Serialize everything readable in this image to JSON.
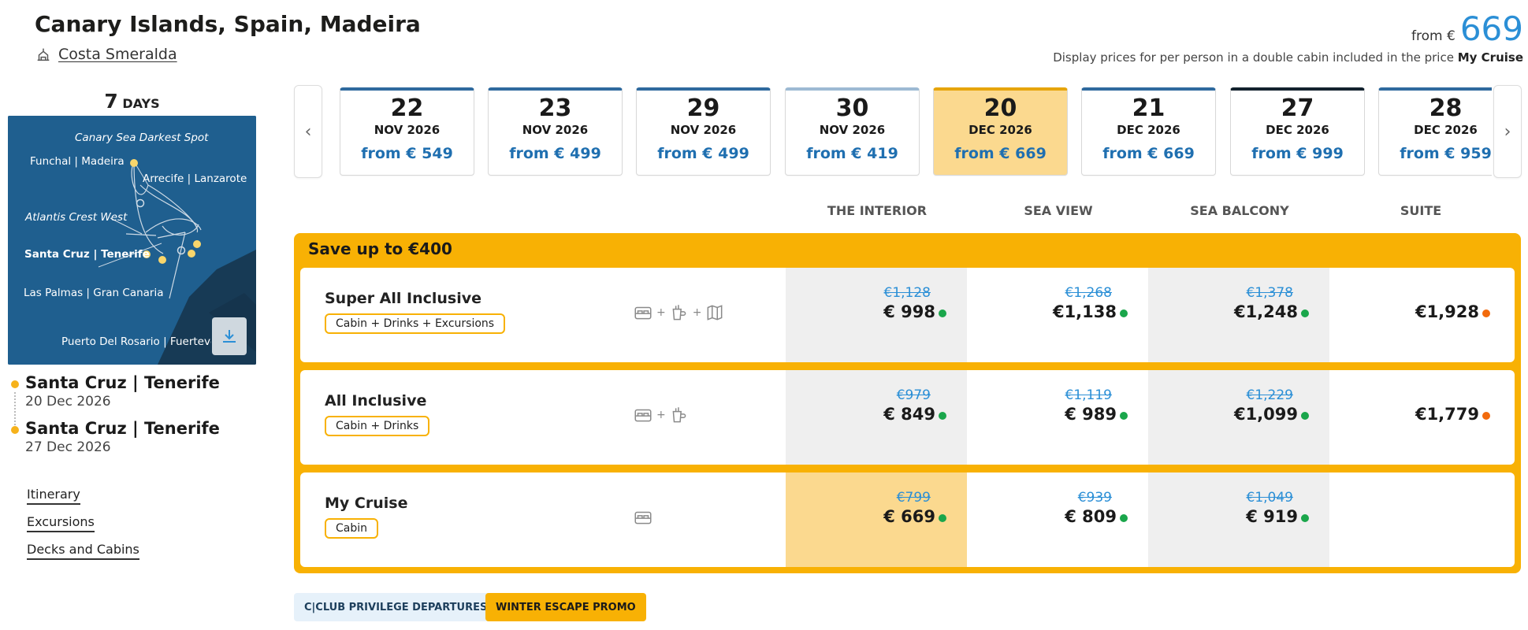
{
  "header": {
    "title": "Canary Islands, Spain, Madeira",
    "ship": "Costa Smeralda",
    "from_label": "from €",
    "from_price": "669",
    "display_note_prefix": "Display prices for per person in a double cabin included in the price",
    "display_note_bold": "My Cruise"
  },
  "sidebar": {
    "days_number": "7",
    "days_label": "DAYS",
    "map_labels": {
      "darkest_spot": "Canary Sea Darkest Spot",
      "funchal": "Funchal | Madeira",
      "arrecife": "Arrecife | Lanzarote",
      "atlantis": "Atlantis Crest West",
      "santa_cruz": "Santa Cruz | Tenerife",
      "las_palmas": "Las Palmas | Gran Canaria",
      "puerto": "Puerto Del Rosario | Fuerteventura"
    },
    "departure": {
      "port": "Santa Cruz | Tenerife",
      "date": "20 Dec 2026"
    },
    "arrival": {
      "port": "Santa Cruz | Tenerife",
      "date": "27 Dec 2026"
    },
    "links": [
      "Itinerary",
      "Excursions",
      "Decks and Cabins"
    ]
  },
  "dates": [
    {
      "day": "22",
      "month": "NOV 2026",
      "price": "from € 549"
    },
    {
      "day": "23",
      "month": "NOV 2026",
      "price": "from € 499"
    },
    {
      "day": "29",
      "month": "NOV 2026",
      "price": "from € 499"
    },
    {
      "day": "30",
      "month": "NOV 2026",
      "price": "from € 419"
    },
    {
      "day": "20",
      "month": "DEC 2026",
      "price": "from € 669",
      "selected": true
    },
    {
      "day": "21",
      "month": "DEC 2026",
      "price": "from € 669"
    },
    {
      "day": "27",
      "month": "DEC 2026",
      "price": "from € 999"
    },
    {
      "day": "28",
      "month": "DEC 2026",
      "price": "from € 959"
    }
  ],
  "columns": [
    "THE INTERIOR",
    "SEA VIEW",
    "SEA BALCONY",
    "SUITE"
  ],
  "promo_title": "Save up to €400",
  "packages": [
    {
      "name": "Super All Inclusive",
      "pill": "Cabin + Drinks + Excursions",
      "prices": [
        {
          "old": "€1,128",
          "new": "€ 998",
          "avail": "green"
        },
        {
          "old": "€1,268",
          "new": "€1,138",
          "avail": "green"
        },
        {
          "old": "€1,378",
          "new": "€1,248",
          "avail": "green"
        },
        {
          "old": "",
          "new": "€1,928",
          "avail": "orange"
        }
      ]
    },
    {
      "name": "All Inclusive",
      "pill": "Cabin + Drinks",
      "prices": [
        {
          "old": "€979",
          "new": "€ 849",
          "avail": "green"
        },
        {
          "old": "€1,119",
          "new": "€ 989",
          "avail": "green"
        },
        {
          "old": "€1,229",
          "new": "€1,099",
          "avail": "green"
        },
        {
          "old": "",
          "new": "€1,779",
          "avail": "orange"
        }
      ]
    },
    {
      "name": "My Cruise",
      "pill": "Cabin",
      "prices": [
        {
          "old": "€799",
          "new": "€ 669",
          "avail": "green"
        },
        {
          "old": "€939",
          "new": "€ 809",
          "avail": "green"
        },
        {
          "old": "€1,049",
          "new": "€ 919",
          "avail": "green"
        }
      ]
    }
  ],
  "badges": {
    "club": "C|CLUB PRIVILEGE DEPARTURES",
    "winter": "WINTER ESCAPE PROMO"
  },
  "colors": {
    "accent": "#f8b104",
    "blue": "#2b8fd6",
    "available": "#1aa64b",
    "limited": "#f26a0c"
  }
}
